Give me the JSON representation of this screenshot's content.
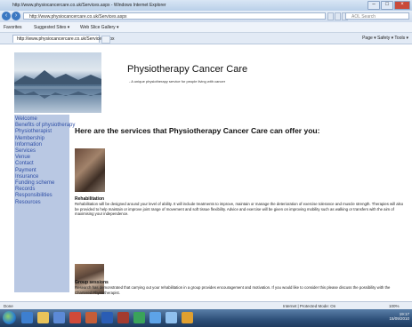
{
  "window": {
    "title": "http://www.physiocancercare.co.uk/Services.aspx - Windows Internet Explorer"
  },
  "address": {
    "url": "http://www.physiocancercare.co.uk/Services.aspx",
    "search_placeholder": "AOL Search"
  },
  "favorites": {
    "label": "Favorites",
    "suggested": "Suggested Sites ▾",
    "gallery": "Web Slice Gallery ▾"
  },
  "tab": {
    "label": "http://www.physiocancercare.co.uk/Services.aspx"
  },
  "commandbar": {
    "text": "Page ▾   Safety ▾   Tools ▾"
  },
  "site": {
    "title": "Physiotherapy Cancer Care",
    "subtitle": "- A unique physiotherapy service for people living with cancer"
  },
  "sidebar": {
    "items": [
      "Welcome",
      "Benefits of physiotherapy",
      "Physiotherapist",
      "Membership",
      "Information",
      "Services",
      "Venue",
      "Contact",
      "Payment",
      "Insurance",
      "Funding scheme",
      "Records",
      "Responsibilities",
      "Resources"
    ]
  },
  "main": {
    "heading": "Here are the services that Physiotherapy Cancer Care can offer you:",
    "sections": [
      {
        "title": "Rehabilitation",
        "text": "Rehabilitation will be designed around your level of ability. It will include treatments to improve, maintain or manage the deterioration of exercise tolerance and muscle strength. Therapies will also be provided to help maintain or improve joint range of movement and soft tissue flexibility. Advice and exercise will be given on improving mobility such as walking or transfers with the aim of maximising your independence."
      },
      {
        "title": "Group sessions",
        "text": "Research has demonstrated that carrying out your rehabilitation in a group provides encouragement and motivation. If you would like to consider this please discuss the possibility with the Chartered Physiotherapist."
      }
    ]
  },
  "status": {
    "left": "Done",
    "zone": "Internet | Protected Mode: On",
    "zoom": "100%"
  },
  "clock": {
    "time": "19:17",
    "date": "15/09/2010"
  },
  "colors": {
    "sidebar_bg": "#b9c8e3",
    "link": "#2f4fa6"
  }
}
